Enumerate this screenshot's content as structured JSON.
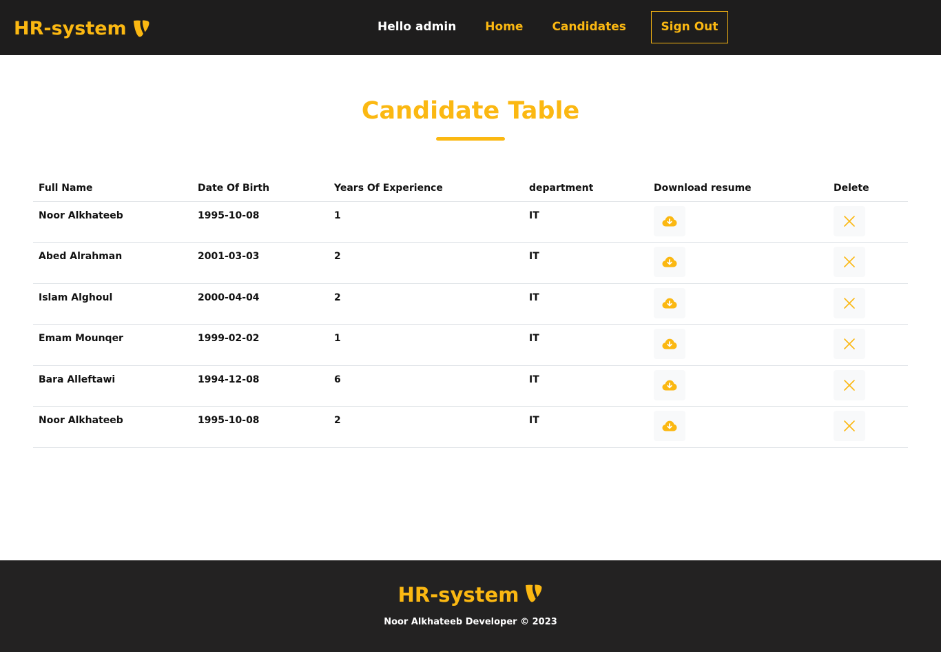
{
  "nav": {
    "brand": "HR-system",
    "brand_icon": "typo3-logo-icon",
    "greeting": "Hello admin",
    "links": [
      "Home",
      "Candidates"
    ],
    "signout_label": "Sign Out"
  },
  "page": {
    "title": "Candidate Table"
  },
  "table": {
    "headers": [
      "Full Name",
      "Date Of Birth",
      "Years Of Experience",
      "department",
      "Download resume",
      "Delete"
    ],
    "rows": [
      {
        "name": "Noor Alkhateeb",
        "dob": "1995-10-08",
        "experience": "1",
        "department": "IT"
      },
      {
        "name": "Abed Alrahman",
        "dob": "2001-03-03",
        "experience": "2",
        "department": "IT"
      },
      {
        "name": "Islam Alghoul",
        "dob": "2000-04-04",
        "experience": "2",
        "department": "IT"
      },
      {
        "name": "Emam Mounqer",
        "dob": "1999-02-02",
        "experience": "1",
        "department": "IT"
      },
      {
        "name": "Bara Alleftawi",
        "dob": "1994-12-08",
        "experience": "6",
        "department": "IT"
      },
      {
        "name": "Noor Alkhateeb",
        "dob": "1995-10-08",
        "experience": "2",
        "department": "IT"
      }
    ],
    "download_icon": "cloud-download-icon",
    "delete_icon": "close-icon"
  },
  "footer": {
    "brand": "HR-system",
    "text": "Noor Alkhateeb Developer © 2023"
  },
  "colors": {
    "accent": "#fbb812",
    "nav_bg": "#1e1d1d",
    "footer_bg": "#232222"
  }
}
